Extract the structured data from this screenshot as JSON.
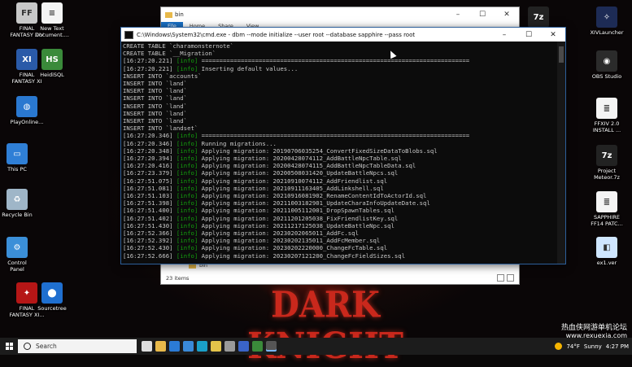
{
  "desktop": {
    "left_icons": [
      {
        "label": "FINAL\nFANTASY XIV",
        "icon": "ffxiv-icon",
        "color": "#c8c8c8",
        "glyph": "FF"
      },
      {
        "label": "New Text\nDocument....",
        "icon": "text-document-icon",
        "color": "#f4f4f4",
        "glyph": "≡"
      },
      {
        "label": "FINAL\nFANTASY XI",
        "icon": "ffxi-icon",
        "color": "#2a5aa8",
        "glyph": "XI"
      },
      {
        "label": "HeidiSQL",
        "icon": "heidisql-icon",
        "color": "#3a8a3a",
        "glyph": "HS"
      },
      {
        "label": "PlayOnline...",
        "icon": "playonline-icon",
        "color": "#2a78d0",
        "glyph": "◍"
      },
      {
        "label": "This PC",
        "icon": "this-pc-icon",
        "color": "#2f7fd6",
        "glyph": "▭"
      },
      {
        "label": "Recycle Bin",
        "icon": "recycle-bin-icon",
        "color": "#9fb6c8",
        "glyph": "♻"
      },
      {
        "label": "Control\nPanel",
        "icon": "control-panel-icon",
        "color": "#3b8fd8",
        "glyph": "⚙"
      },
      {
        "label": "FINAL\nFANTASY XI...",
        "icon": "ffxi-alt-icon",
        "color": "#b51616",
        "glyph": "✦"
      },
      {
        "label": "Sourcetree",
        "icon": "sourcetree-icon",
        "color": "#1f6fd0",
        "glyph": "⬤"
      }
    ],
    "right_icons": [
      {
        "label": "",
        "icon": "7zip-icon",
        "color": "#222222",
        "glyph": "7z"
      },
      {
        "label": "XIVLauncher",
        "icon": "xivlauncher-icon",
        "color": "#1d2b55",
        "glyph": "✧"
      },
      {
        "label": "OBS Studio",
        "icon": "obs-studio-icon",
        "color": "#2b2b2b",
        "glyph": "◉"
      },
      {
        "label": "FFXIV 2.0\nINSTALL ...",
        "icon": "install-document-icon",
        "color": "#f4f4f4",
        "glyph": "≣"
      },
      {
        "label": "Project\nMeteor.7z",
        "icon": "archive-7z-icon",
        "color": "#222222",
        "glyph": "7z"
      },
      {
        "label": "SAPPHIRE\nFF14 PATC...",
        "icon": "patch-document-icon",
        "color": "#f4f4f4",
        "glyph": "≣"
      },
      {
        "label": "ex1.ver",
        "icon": "ver-file-icon",
        "color": "#cfe6ff",
        "glyph": "◧"
      }
    ],
    "background_logo": "DARK KNIGHT"
  },
  "explorer": {
    "title": "bin",
    "ribbon_tabs": [
      "File",
      "Home",
      "Share",
      "View"
    ],
    "breadcrumb": "bin",
    "item_count": "23 items"
  },
  "cmd": {
    "title": "C:\\Windows\\System32\\cmd.exe - dbm  --mode initialize --user root --database sapphire --pass root",
    "lines": [
      {
        "ts": "",
        "tag": "",
        "text": "CREATE TABLE `charamonsternote`"
      },
      {
        "ts": "",
        "tag": "",
        "text": "CREATE TABLE `__Migration`"
      },
      {
        "ts": "[16:27:20.221]",
        "tag": "[info]",
        "text": " ==========================================================================="
      },
      {
        "ts": "[16:27:20.221]",
        "tag": "[info]",
        "text": " Inserting default values..."
      },
      {
        "ts": "",
        "tag": "",
        "text": "INSERT INTO `accounts`"
      },
      {
        "ts": "",
        "tag": "",
        "text": "INSERT INTO `land`"
      },
      {
        "ts": "",
        "tag": "",
        "text": "INSERT INTO `land`"
      },
      {
        "ts": "",
        "tag": "",
        "text": "INSERT INTO `land`"
      },
      {
        "ts": "",
        "tag": "",
        "text": "INSERT INTO `land`"
      },
      {
        "ts": "",
        "tag": "",
        "text": "INSERT INTO `land`"
      },
      {
        "ts": "",
        "tag": "",
        "text": "INSERT INTO `land`"
      },
      {
        "ts": "",
        "tag": "",
        "text": "INSERT INTO `landset`"
      },
      {
        "ts": "[16:27:20.346]",
        "tag": "[info]",
        "text": " ==========================================================================="
      },
      {
        "ts": "[16:27:20.346]",
        "tag": "[info]",
        "text": " Running migrations..."
      },
      {
        "ts": "[16:27:20.348]",
        "tag": "[info]",
        "text": " Applying migration: 20190706035254_ConvertFixedSizeDataToBlobs.sql"
      },
      {
        "ts": "[16:27:20.394]",
        "tag": "[info]",
        "text": " Applying migration: 20200428074112_AddBattleNpcTable.sql"
      },
      {
        "ts": "[16:27:20.416]",
        "tag": "[info]",
        "text": " Applying migration: 20200428074115_AddBattleNpcTableData.sql"
      },
      {
        "ts": "[16:27:23.379]",
        "tag": "[info]",
        "text": " Applying migration: 20200508031420_UpdateBattleNpcs.sql"
      },
      {
        "ts": "[16:27:51.075]",
        "tag": "[info]",
        "text": " Applying migration: 20210910074112_AddFriendlist.sql"
      },
      {
        "ts": "[16:27:51.081]",
        "tag": "[info]",
        "text": " Applying migration: 20210911163405_AddLinkshell.sql"
      },
      {
        "ts": "[16:27:51.103]",
        "tag": "[info]",
        "text": " Applying migration: 20210916081902_RenameContentIdToActorId.sql"
      },
      {
        "ts": "[16:27:51.398]",
        "tag": "[info]",
        "text": " Applying migration: 20211003182901_UpdateCharaInfoUpdateDate.sql"
      },
      {
        "ts": "[16:27:51.400]",
        "tag": "[info]",
        "text": " Applying migration: 20211005112001_DropSpawnTables.sql"
      },
      {
        "ts": "[16:27:51.402]",
        "tag": "[info]",
        "text": " Applying migration: 20211201205038_FixFriendlistKey.sql"
      },
      {
        "ts": "[16:27:51.430]",
        "tag": "[info]",
        "text": " Applying migration: 20211217125038_UpdateBattleNpc.sql"
      },
      {
        "ts": "[16:27:52.366]",
        "tag": "[info]",
        "text": " Applying migration: 20230202065011_AddFc.sql"
      },
      {
        "ts": "[16:27:52.392]",
        "tag": "[info]",
        "text": " Applying migration: 20230202135011_AddFcMember.sql"
      },
      {
        "ts": "[16:27:52.430]",
        "tag": "[info]",
        "text": " Applying migration: 20230202220000_ChangeFcTable.sql"
      },
      {
        "ts": "[16:27:52.666]",
        "tag": "[info]",
        "text": " Applying migration: 20230207121200_ChangeFcFieldSizes.sql"
      },
      {
        "ts": "",
        "tag": "",
        "text": "_"
      }
    ]
  },
  "taskbar": {
    "search_placeholder": "Search",
    "apps": [
      {
        "icon": "task-view-icon",
        "color": "#dddddd"
      },
      {
        "icon": "file-explorer-icon",
        "color": "#e8b94a"
      },
      {
        "icon": "mail-icon",
        "color": "#2b7bd6"
      },
      {
        "icon": "store-icon",
        "color": "#3a8ad8"
      },
      {
        "icon": "edge-icon",
        "color": "#1aa0c8"
      },
      {
        "icon": "chrome-icon",
        "color": "#e4c44a"
      },
      {
        "icon": "obs-icon",
        "color": "#9a9a9a"
      },
      {
        "icon": "xivlauncher-task-icon",
        "color": "#3a64c8"
      },
      {
        "icon": "heidisql-task-icon",
        "color": "#3a8a3a"
      },
      {
        "icon": "cmd-task-icon",
        "color": "#555555"
      }
    ],
    "weather_temp": "74°F",
    "weather_text": "Sunny",
    "time": "4:27 PM"
  },
  "watermark": {
    "title": "热血侠网游单机论坛",
    "url": "www.rexuexia.com"
  }
}
